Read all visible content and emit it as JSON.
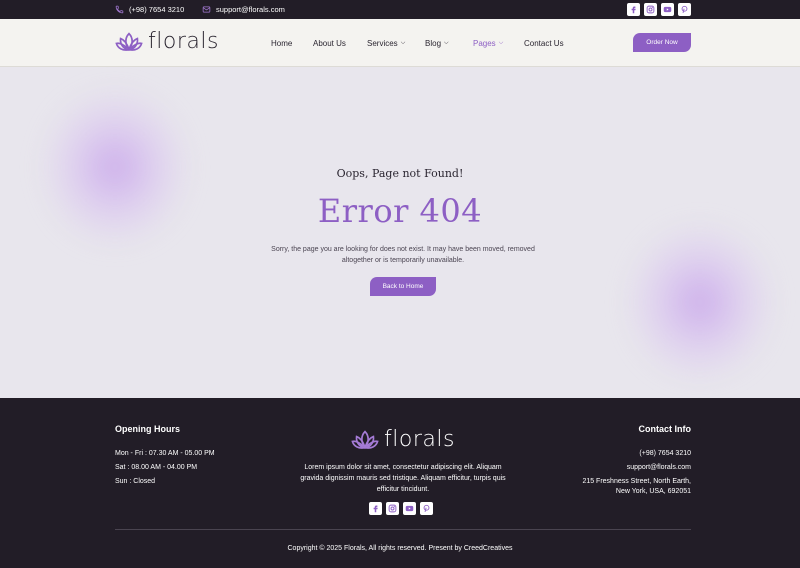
{
  "topbar": {
    "phone": "(+98) 7654 3210",
    "email": "support@florals.com",
    "socials": [
      "facebook-icon",
      "instagram-icon",
      "youtube-icon",
      "pinterest-icon"
    ]
  },
  "brand": {
    "name": "florals",
    "color": "#8d5fc4",
    "dark": "#221d27"
  },
  "nav": {
    "items": [
      {
        "label": "Home"
      },
      {
        "label": "About Us"
      },
      {
        "label": "Services",
        "dropdown": true
      },
      {
        "label": "Blog",
        "dropdown": true
      },
      {
        "label": "Pages",
        "dropdown": true,
        "active": true
      },
      {
        "label": "Contact Us"
      }
    ],
    "order_button": "Order Now"
  },
  "error_page": {
    "subtitle": "Oops, Page not Found!",
    "title": "Error 404",
    "message_line1": "Sorry, the page you are looking for does not exist. It may have been moved, removed",
    "message_line2": "altogether or is temporarily unavailable.",
    "back_button": "Back to Home"
  },
  "footer": {
    "hours": {
      "heading": "Opening Hours",
      "lines": [
        "Mon - Fri : 07.30 AM - 05.00 PM",
        "Sat : 08.00 AM - 04.00 PM",
        "Sun : Closed"
      ]
    },
    "about": {
      "line1": "Lorem ipsum dolor sit amet, consectetur adipiscing elit. Aliquam",
      "line2": "gravida dignissim mauris sed tristique. Aliquam efficitur, turpis quis",
      "line3": "efficitur tincidunt."
    },
    "contact": {
      "heading": "Contact Info",
      "phone": "(+98) 7654 3210",
      "email": "support@florals.com",
      "address_line1": "215 Freshness Street, North Earth,",
      "address_line2": "New York, USA, 692051"
    },
    "copyright": "Copyright © 2025 Florals, All rights reserved. Present by CreedCreatives"
  }
}
